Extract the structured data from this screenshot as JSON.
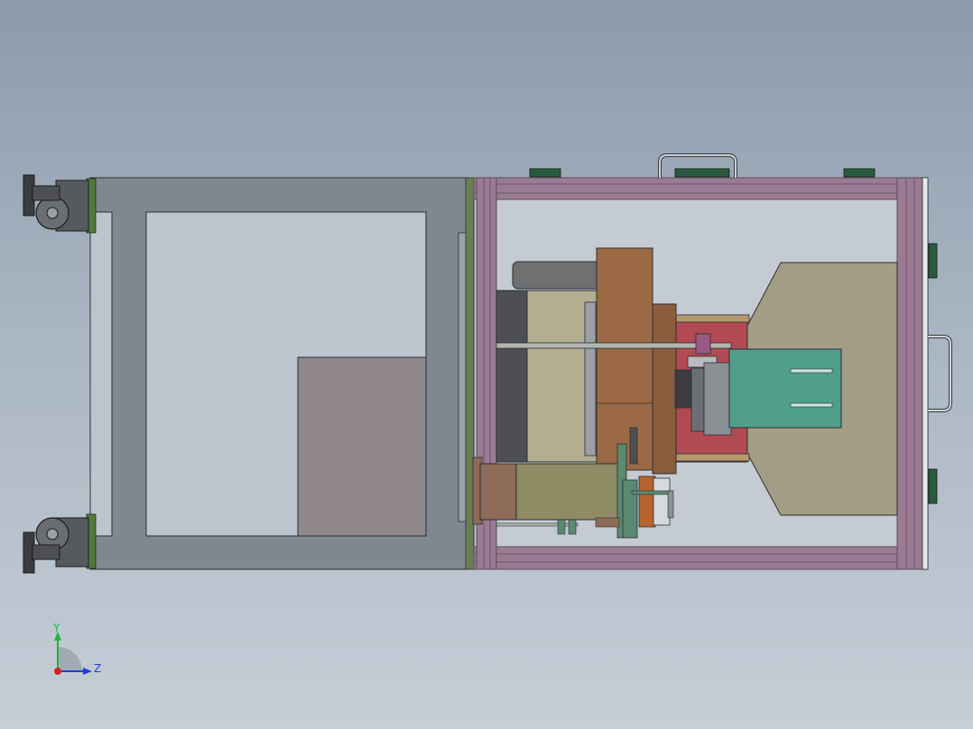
{
  "viewport": {
    "background_top": "#8c9aab",
    "background_bottom": "#c6ced7"
  },
  "triad": {
    "y_label": "Y",
    "z_label": "Z",
    "y_color": "#1db53a",
    "z_color": "#1f3fd8",
    "x_color": "#d81f1f"
  },
  "palette": {
    "frame_gray": "#7f8790",
    "frame_outline": "#2b2f33",
    "rail_purple": "#9a7b93",
    "rail_dark": "#5d4b5a",
    "inner_panel": "#c4cbd2",
    "copper": "#9b6a45",
    "gold_bowl": "#b3ae90",
    "tan_hopper": "#a49d85",
    "teal_block": "#4f9f8a",
    "red_plate": "#b14a52",
    "olive_cyl": "#8f8b65",
    "brown_block": "#8e6a58",
    "mauve_box": "#8f878c",
    "dark_gray": "#4d4f52",
    "green_flange": "#4f7a3e"
  }
}
